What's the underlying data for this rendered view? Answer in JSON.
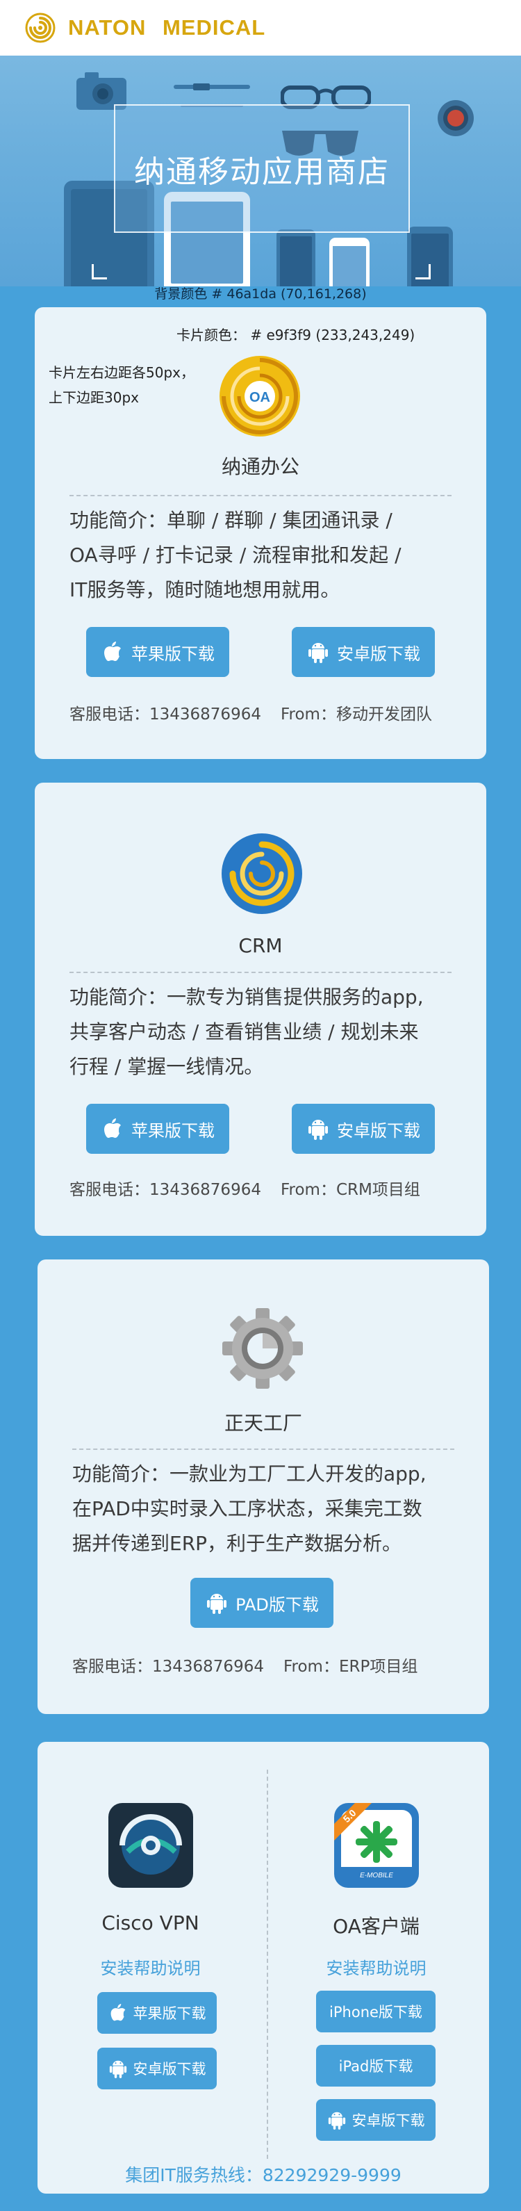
{
  "header": {
    "brand": "NATON   MEDICAL",
    "logo_icon": "swirl-logo-icon",
    "brand_color": "#d7a60f"
  },
  "banner": {
    "title": "纳通移动应用商店"
  },
  "background_note": "背景颜色 # 46a1da (70,161,268)",
  "colors": {
    "background": "#46a1da",
    "card": "#e9f3f9",
    "button": "#46a1da"
  },
  "cards": [
    {
      "annot_color": "卡片颜色： # e9f3f9 (233,243,249)",
      "annot_margin_1": "卡片左右边距各50px，",
      "annot_margin_2": "上下边距30px",
      "icon": "naton-oa-logo-icon",
      "title": "纳通办公",
      "desc_1": "功能简介：单聊 / 群聊 / 集团通讯录 /",
      "desc_2": "OA寻呼 / 打卡记录 / 流程审批和发起 /",
      "desc_3": "IT服务等，随时随地想用就用。",
      "ios_label": "苹果版下载",
      "android_label": "安卓版下载",
      "phone": "客服电话：13436876964",
      "from": "From：移动开发团队"
    },
    {
      "icon": "crm-logo-icon",
      "title": "CRM",
      "desc_1": "功能简介：一款专为销售提供服务的app,",
      "desc_2": "共享客户动态 / 查看销售业绩 / 规划未来",
      "desc_3": "行程 / 掌握一线情况。",
      "ios_label": "苹果版下载",
      "android_label": "安卓版下载",
      "phone": "客服电话：13436876964",
      "from": "From：CRM项目组"
    },
    {
      "icon": "gear-icon",
      "title": "正天工厂",
      "desc_1": "功能简介：一款业为工厂工人开发的app,",
      "desc_2": "在PAD中实时录入工序状态，采集完工数",
      "desc_3": "据并传递到ERP，利于生产数据分析。",
      "pad_label": "PAD版下载",
      "phone": "客服电话：13436876964",
      "from": "From：ERP项目组"
    },
    {
      "left": {
        "icon": "cisco-vpn-icon",
        "name": "Cisco VPN",
        "help": "安装帮助说明",
        "ios_label": "苹果版下载",
        "android_label": "安卓版下载"
      },
      "right": {
        "icon": "oa-client-icon",
        "name": "OA客户端",
        "help": "安装帮助说明",
        "iphone_label": "iPhone版下载",
        "ipad_label": "iPad版下载",
        "android_label": "安卓版下载"
      },
      "hotline": "集团IT服务热线：82292929-9999"
    }
  ]
}
